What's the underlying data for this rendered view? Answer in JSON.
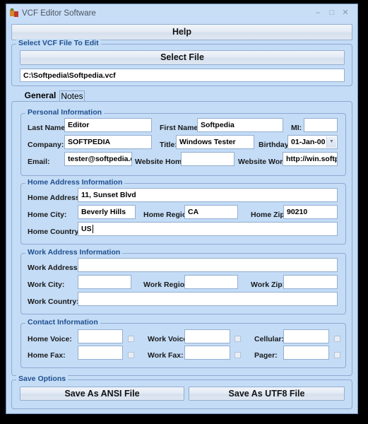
{
  "window": {
    "title": "VCF Editor Software",
    "controls": {
      "minimize": "–",
      "maximize": "□",
      "close": "✕"
    },
    "icon": "app-icon"
  },
  "toolbar": {
    "help_label": "Help"
  },
  "select_file_group": {
    "legend": "Select VCF File To Edit",
    "select_button": "Select File",
    "file_path": "C:\\Softpedia\\Softpedia.vcf"
  },
  "tabs": [
    {
      "label": "General",
      "active": true
    },
    {
      "label": "Notes",
      "active": false
    }
  ],
  "personal": {
    "legend": "Personal Information",
    "last_name_label": "Last Name:",
    "last_name": "Editor",
    "first_name_label": "First Name:",
    "first_name": "Softpedia",
    "mi_label": "MI:",
    "mi": "",
    "company_label": "Company:",
    "company": "SOFTPEDIA",
    "title_label": "Title:",
    "title": "Windows Tester",
    "birthday_label": "Birthday:",
    "birthday": "01-Jan-00",
    "email_label": "Email:",
    "email": "tester@softpedia.con",
    "website_home_label": "Website Home:",
    "website_home": "",
    "website_work_label": "Website Work:",
    "website_work": "http://win.softpedi"
  },
  "home_address": {
    "legend": "Home Address Information",
    "address_label": "Home Address:",
    "address": "11, Sunset Blvd",
    "city_label": "Home City:",
    "city": "Beverly Hills",
    "region_label": "Home Region:",
    "region": "CA",
    "zip_label": "Home Zip:",
    "zip": "90210",
    "country_label": "Home Country:",
    "country": "US"
  },
  "work_address": {
    "legend": "Work Address Information",
    "address_label": "Work Address:",
    "address": "",
    "city_label": "Work City:",
    "city": "",
    "region_label": "Work Region:",
    "region": "",
    "zip_label": "Work Zip:",
    "zip": "",
    "country_label": "Work Country:",
    "country": ""
  },
  "contact": {
    "legend": "Contact Information",
    "home_voice_label": "Home Voice:",
    "home_voice": "",
    "work_voice_label": "Work Voice:",
    "work_voice": "",
    "cellular_label": "Cellular:",
    "cellular": "",
    "home_fax_label": "Home Fax:",
    "home_fax": "",
    "work_fax_label": "Work Fax:",
    "work_fax": "",
    "pager_label": "Pager:",
    "pager": ""
  },
  "save_options": {
    "legend": "Save Options",
    "ansi_button": "Save As ANSI File",
    "utf8_button": "Save As UTF8 File"
  }
}
